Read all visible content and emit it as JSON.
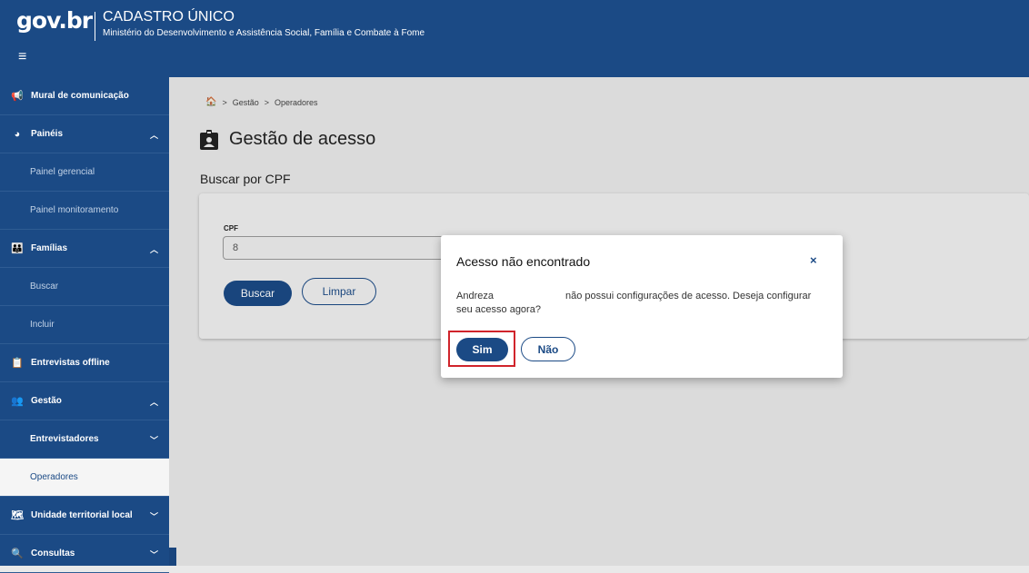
{
  "header": {
    "logo": "gov.br",
    "title": "CADASTRO ÚNICO",
    "subtitle": "Ministério do Desenvolvimento e Assistência Social, Família e Combate à Fome",
    "menu_icon": "hamburger-icon"
  },
  "sidebar": {
    "items": [
      {
        "label": "Mural de comunicação",
        "icon": "megaphone-icon"
      },
      {
        "label": "Painéis",
        "icon": "pie-chart-icon"
      },
      {
        "label": "Painel gerencial"
      },
      {
        "label": "Painel monitoramento"
      },
      {
        "label": "Famílias",
        "icon": "family-icon"
      },
      {
        "label": "Buscar"
      },
      {
        "label": "Incluir"
      },
      {
        "label": "Entrevistas offline",
        "icon": "clipboard-icon"
      },
      {
        "label": "Gestão",
        "icon": "users-gear-icon"
      },
      {
        "label": "Entrevistadores"
      },
      {
        "label": "Operadores"
      },
      {
        "label": "Unidade territorial local",
        "icon": "map-icon"
      },
      {
        "label": "Consultas",
        "icon": "search-icon"
      }
    ]
  },
  "breadcrumb": {
    "items": [
      "Gestão",
      "Operadores"
    ],
    "separator": ">"
  },
  "page": {
    "title": "Gestão de acesso",
    "section_title": "Buscar por CPF"
  },
  "form": {
    "cpf_label": "CPF",
    "cpf_value": "8",
    "search_button": "Buscar",
    "clear_button": "Limpar"
  },
  "modal": {
    "title": "Acesso não encontrado",
    "close_symbol": "×",
    "message_name": "Andreza",
    "message_text": "não possui configurações de acesso. Deseja configurar seu acesso agora?",
    "yes_button": "Sim",
    "no_button": "Não"
  },
  "colors": {
    "primary": "#1b4a85",
    "highlight": "#d0242b"
  }
}
